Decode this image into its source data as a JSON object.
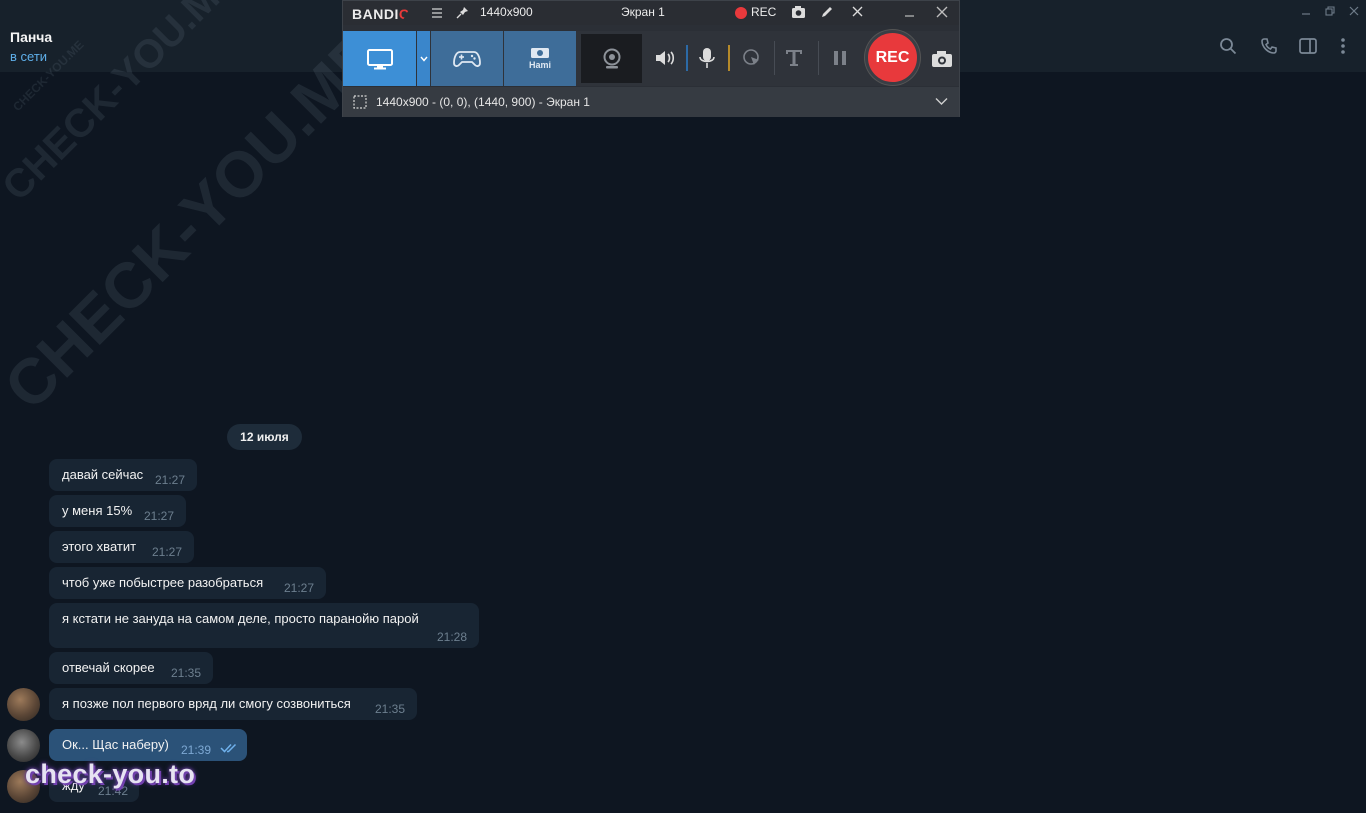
{
  "chat": {
    "name": "Панча",
    "status": "в сети",
    "date_separator": "12 июля",
    "messages": [
      {
        "text": "давай сейчас",
        "time": "21:27"
      },
      {
        "text": "у меня 15%",
        "time": "21:27"
      },
      {
        "text": "этого хватит",
        "time": "21:27"
      },
      {
        "text": "чтоб уже побыстрее разобраться",
        "time": "21:27"
      },
      {
        "text": "я кстати не зануда на самом деле, просто паранойю парой",
        "time": "21:28"
      },
      {
        "text": "отвечай скорее",
        "time": "21:35"
      },
      {
        "text": "я позже пол первого вряд ли смогу созвониться",
        "time": "21:35"
      },
      {
        "text": "Ок... Щас наберу)",
        "time": "21:39",
        "outgoing": true,
        "read": true
      },
      {
        "text": "жду",
        "time": "21:42"
      }
    ],
    "header_icons": [
      "search-icon",
      "phone-icon",
      "sidebar-toggle-icon",
      "more-vertical-icon"
    ]
  },
  "bandicam": {
    "logo_text": "BANDI",
    "logo_accent": "C",
    "resolution": "1440x900",
    "screen_name": "Экран 1",
    "rec_label": "REC",
    "rec_button_label": "REC",
    "area_text": "1440x900 - (0, 0), (1440, 900) - Экран 1",
    "hdmi_label": "Hami",
    "colors": {
      "rec_red": "#e8393c",
      "active_mode": "#3d8fd6",
      "inactive_mode": "#3e6d99"
    }
  },
  "watermarks": {
    "diagonal": "CHECK-YOU.ME",
    "brand": "check-you.to"
  },
  "colors": {
    "chat_bg": "#0e1621",
    "header_bg": "#17212b",
    "incoming_bubble": "#182533",
    "outgoing_bubble": "#2b5278",
    "status_blue": "#5eaee8"
  }
}
